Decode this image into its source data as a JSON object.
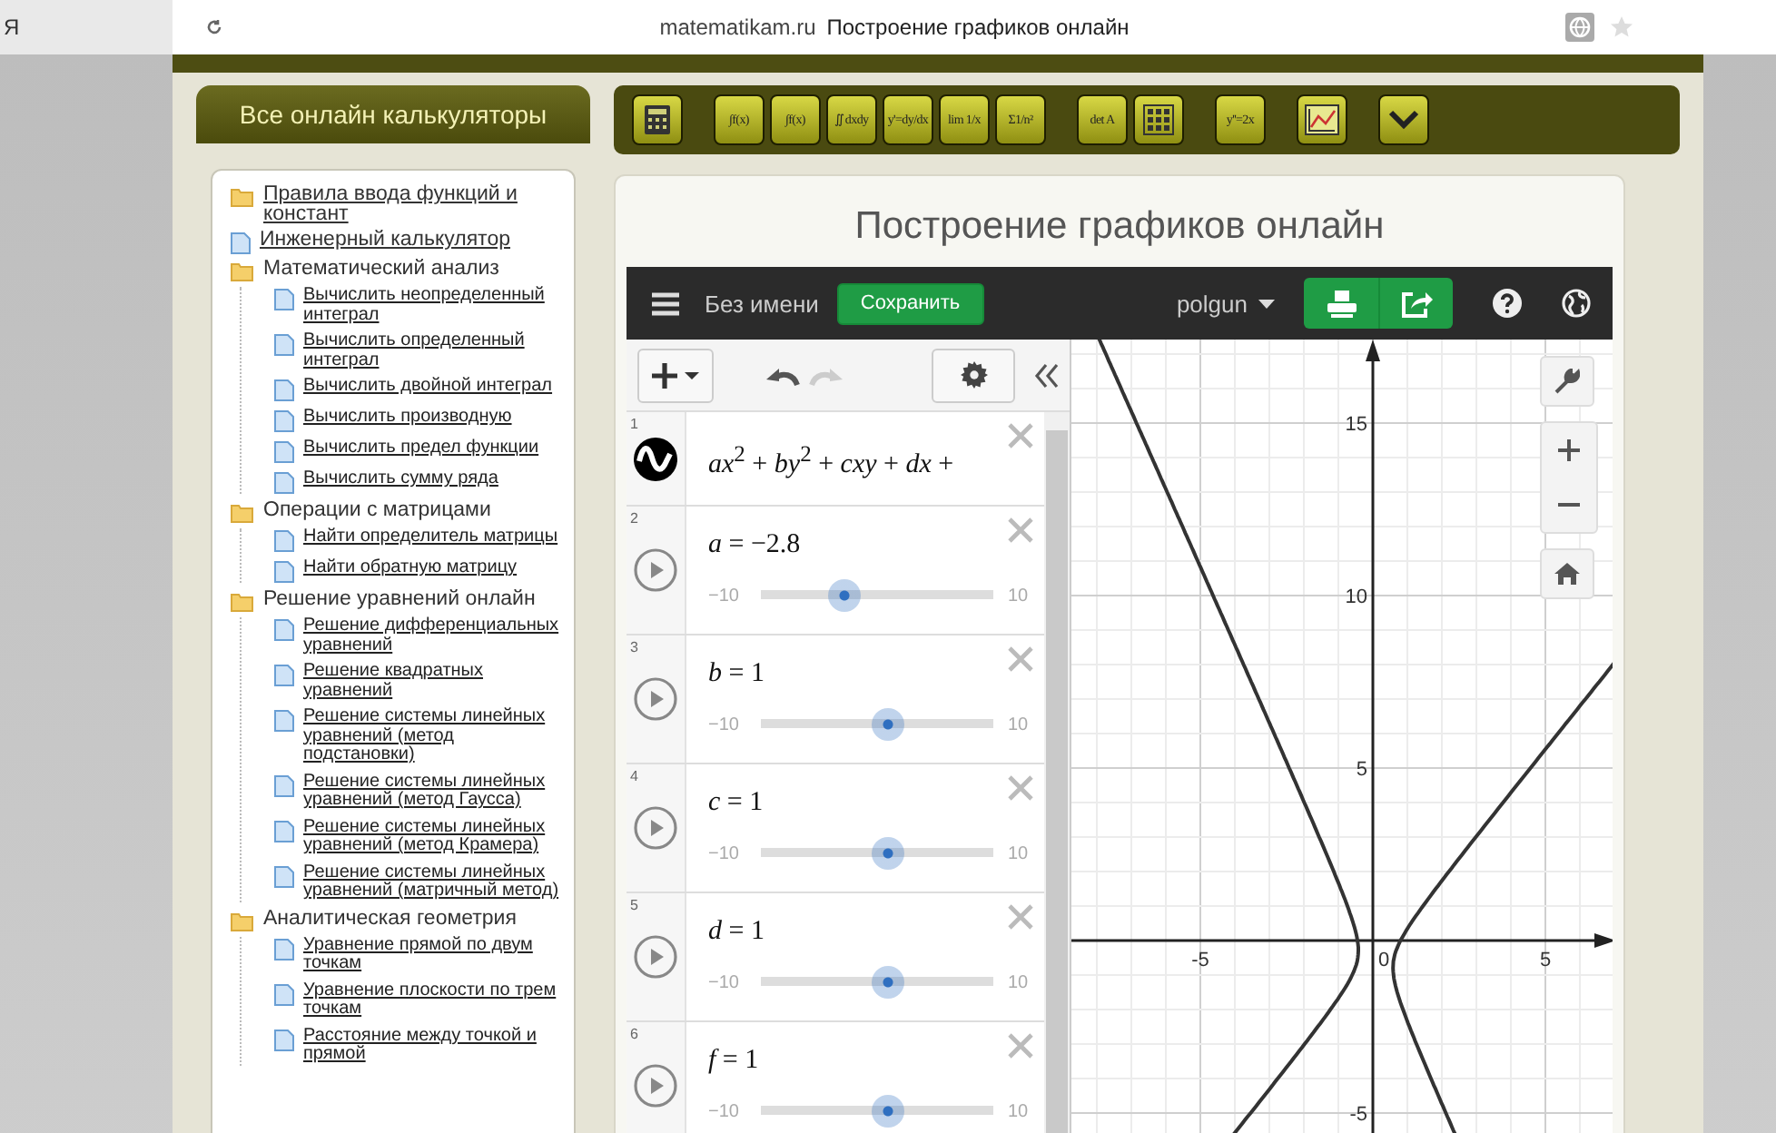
{
  "browser": {
    "tab": "Я",
    "url": "matematikam.ru",
    "page_title": "Построение графиков онлайн"
  },
  "sidebar": {
    "title": "Все онлайн калькуляторы",
    "items": [
      {
        "kind": "folder",
        "label": "Правила ввода функций и констант",
        "link": true
      },
      {
        "kind": "doc",
        "label": "Инженерный калькулятор",
        "link": true
      },
      {
        "kind": "folder",
        "label": "Математический анализ",
        "link": false,
        "children": [
          {
            "kind": "doc",
            "label": "Вычислить неопределенный интеграл",
            "link": true
          },
          {
            "kind": "doc",
            "label": "Вычислить определенный интеграл",
            "link": true
          },
          {
            "kind": "doc",
            "label": "Вычислить двойной интеграл",
            "link": true
          },
          {
            "kind": "doc",
            "label": "Вычислить производную",
            "link": true
          },
          {
            "kind": "doc",
            "label": "Вычислить предел функции",
            "link": true
          },
          {
            "kind": "doc",
            "label": "Вычислить сумму ряда",
            "link": true
          }
        ]
      },
      {
        "kind": "folder",
        "label": "Операции с матрицами",
        "link": false,
        "children": [
          {
            "kind": "doc",
            "label": "Найти определитель матрицы",
            "link": true
          },
          {
            "kind": "doc",
            "label": "Найти обратную матрицу",
            "link": true
          }
        ]
      },
      {
        "kind": "folder",
        "label": "Решение уравнений онлайн",
        "link": false,
        "children": [
          {
            "kind": "doc",
            "label": "Решение дифференциальных уравнений",
            "link": true
          },
          {
            "kind": "doc",
            "label": "Решение квадратных уравнений",
            "link": true
          },
          {
            "kind": "doc",
            "label": "Решение системы линейных уравнений (метод подстановки)",
            "link": true
          },
          {
            "kind": "doc",
            "label": "Решение системы линейных уравнений (метод Гаусса)",
            "link": true
          },
          {
            "kind": "doc",
            "label": "Решение системы линейных уравнений (метод Крамера)",
            "link": true
          },
          {
            "kind": "doc",
            "label": "Решение системы линейных уравнений (матричный метод)",
            "link": true
          }
        ]
      },
      {
        "kind": "folder",
        "label": "Аналитическая геометрия",
        "link": false,
        "children": [
          {
            "kind": "doc",
            "label": "Уравнение прямой по двум точкам",
            "link": true
          },
          {
            "kind": "doc",
            "label": "Уравнение плоскости по трем точкам",
            "link": true
          },
          {
            "kind": "doc",
            "label": "Расстояние между точкой и прямой",
            "link": true
          }
        ]
      }
    ]
  },
  "toolbar": {
    "groups": [
      [
        {
          "kind": "calculator"
        }
      ],
      [
        {
          "kind": "text",
          "label": "∫f(x)"
        },
        {
          "kind": "text",
          "label": "∫f(x)"
        },
        {
          "kind": "text",
          "label": "∬dxdy"
        },
        {
          "kind": "text",
          "label": "y'=dy/dx"
        },
        {
          "kind": "text",
          "label": "lim 1/x"
        },
        {
          "kind": "text",
          "label": "Σ1/n²"
        }
      ],
      [
        {
          "kind": "text",
          "label": "det A"
        },
        {
          "kind": "matrix"
        }
      ],
      [
        {
          "kind": "text",
          "label": "y''=2x"
        }
      ],
      [
        {
          "kind": "graph"
        }
      ],
      [
        {
          "kind": "chevron"
        }
      ]
    ]
  },
  "main": {
    "title": "Построение графиков онлайн"
  },
  "calculator": {
    "name": "Без имени",
    "save": "Сохранить",
    "user": "polgun",
    "expressions": [
      {
        "kind": "formula",
        "number": "1",
        "text": "*ax*$^{2}$ + *by*$^{2}$ + *cxy* + *dx* +"
      },
      {
        "kind": "slider",
        "number": "2",
        "text": "*a* = −2.8",
        "min": "−10",
        "max": "10",
        "level": 0.36
      },
      {
        "kind": "slider",
        "number": "3",
        "text": "*b* = 1",
        "min": "−10",
        "max": "10",
        "level": 0.55
      },
      {
        "kind": "slider",
        "number": "4",
        "text": "*c* = 1",
        "min": "−10",
        "max": "10",
        "level": 0.55
      },
      {
        "kind": "slider",
        "number": "5",
        "text": "*d* = 1",
        "min": "−10",
        "max": "10",
        "level": 0.55
      },
      {
        "kind": "slider",
        "number": "6",
        "text": "*f* = 1",
        "min": "−10",
        "max": "10",
        "level": 0.55
      }
    ]
  },
  "graph": {
    "x_ticks": [
      "-5",
      "0",
      "5"
    ],
    "y_ticks": [
      "15",
      "10",
      "5",
      "-5"
    ]
  }
}
